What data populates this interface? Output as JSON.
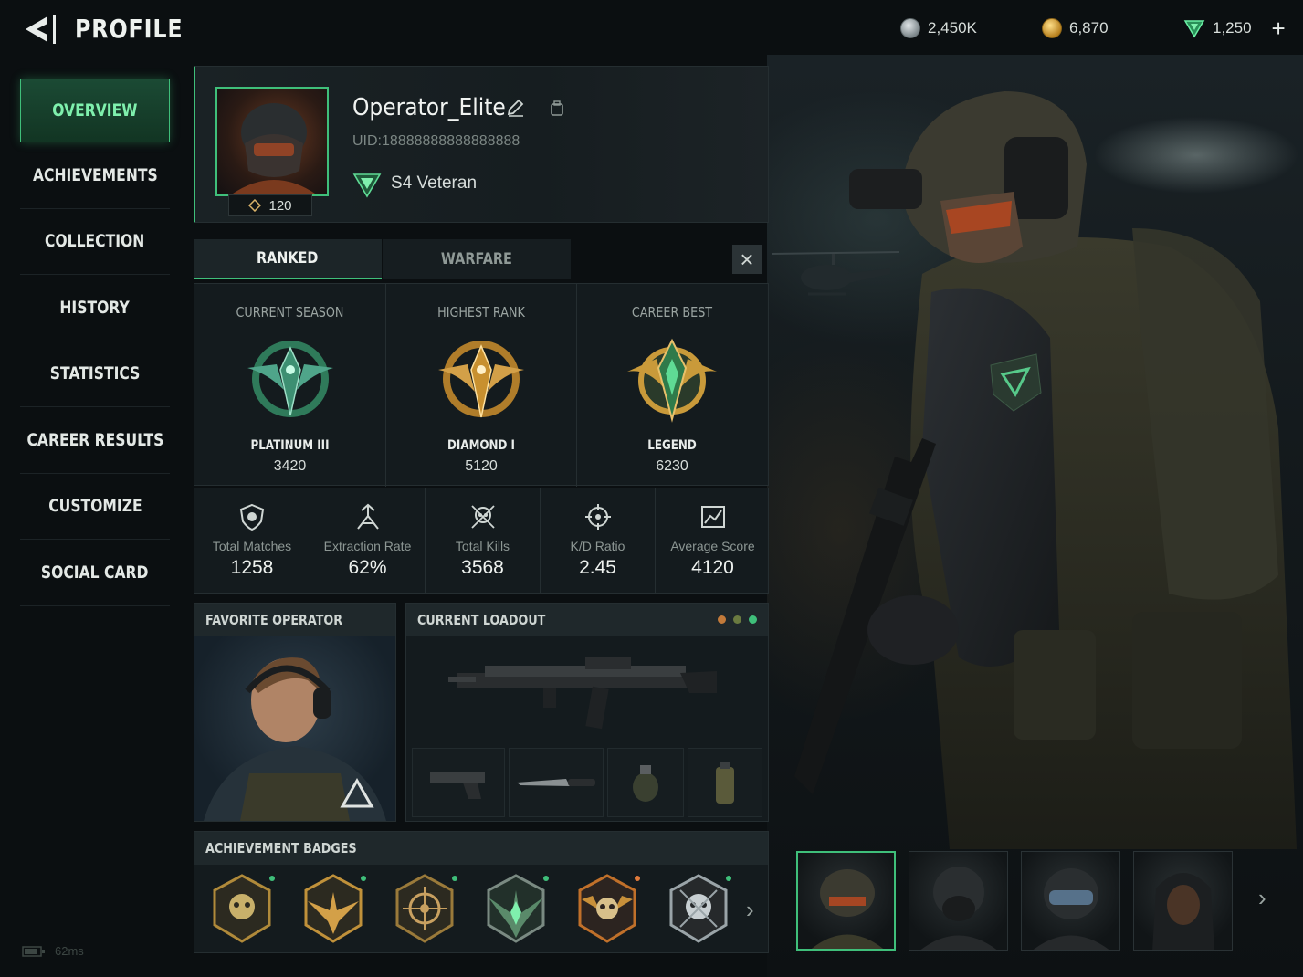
{
  "header": {
    "title": "PROFILE",
    "currencies": [
      {
        "name": "silver-coin-icon",
        "value": "2,450K",
        "color": "#9aa4a8"
      },
      {
        "name": "gold-coin-icon",
        "value": "6,870",
        "color": "#d4a23a"
      },
      {
        "name": "premium-gem-icon",
        "value": "1,250",
        "color": "#3fbf7a"
      }
    ],
    "add_label": "+"
  },
  "sidebar": {
    "items": [
      {
        "label": "OVERVIEW",
        "active": true
      },
      {
        "label": "ACHIEVEMENTS"
      },
      {
        "label": "COLLECTION"
      },
      {
        "label": "HISTORY"
      },
      {
        "label": "STATISTICS"
      },
      {
        "label": "CAREER RESULTS"
      },
      {
        "label": "CUSTOMIZE"
      },
      {
        "label": "SOCIAL CARD"
      }
    ]
  },
  "profile": {
    "username": "Operator_Elite",
    "uid": "UID:18888888888888888",
    "level": "120",
    "rank_label": "S4 Veteran"
  },
  "tabs": {
    "ranked": "RANKED",
    "warfare": "WARFARE",
    "close": "×"
  },
  "ranks": [
    {
      "heading": "CURRENT SEASON",
      "name": "PLATINUM III",
      "score": "3420"
    },
    {
      "heading": "HIGHEST RANK",
      "name": "DIAMOND I",
      "score": "5120"
    },
    {
      "heading": "CAREER BEST",
      "name": "LEGEND",
      "score": "6230"
    }
  ],
  "stats": [
    {
      "icon": "shield-icon",
      "label": "Total Matches",
      "value": "1258"
    },
    {
      "icon": "extraction-icon",
      "label": "Extraction Rate",
      "value": "62%"
    },
    {
      "icon": "skull-icon",
      "label": "Total Kills",
      "value": "3568"
    },
    {
      "icon": "crosshair-icon",
      "label": "K/D Ratio",
      "value": "2.45"
    },
    {
      "icon": "chart-icon",
      "label": "Average Score",
      "value": "4120"
    }
  ],
  "favorite_operator": {
    "heading": "FAVORITE OPERATOR"
  },
  "loadout": {
    "heading": "CURRENT LOADOUT",
    "slots": [
      "pistol-icon",
      "knife-icon",
      "grenade-icon",
      "canister-icon"
    ]
  },
  "achievements": {
    "heading": "ACHIEVEMENT BADGES",
    "badges": [
      "skull-badge-icon",
      "eagle-badge-icon",
      "target-badge-icon",
      "wings-badge-icon",
      "skull-wings-badge-icon",
      "silver-skull-badge-icon"
    ]
  },
  "footer": {
    "ping": "62ms"
  },
  "colors": {
    "accent": "#3fbf7a",
    "gold": "#c9973a",
    "background": "#0b0f11"
  }
}
